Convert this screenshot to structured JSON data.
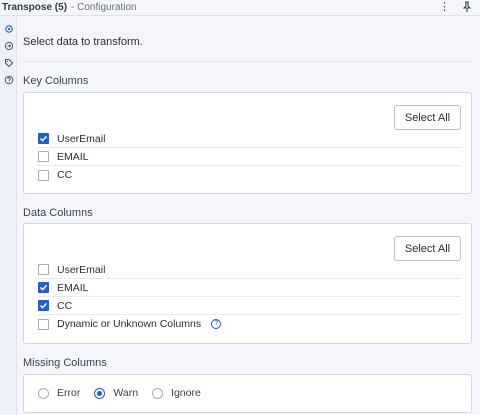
{
  "header": {
    "tool_name": "Transpose (5)",
    "subtitle": "- Configuration",
    "menu_icon": "more-vertical-icon",
    "pin_icon": "pin-icon"
  },
  "sidebar": {
    "icons": [
      "gear-icon",
      "arrow-circle-icon",
      "tag-icon",
      "help-circle-icon"
    ]
  },
  "intro": "Select data to transform.",
  "key_columns": {
    "title": "Key Columns",
    "select_all": "Select All",
    "items": [
      {
        "label": "UserEmail",
        "checked": true
      },
      {
        "label": "EMAIL",
        "checked": false
      },
      {
        "label": "CC",
        "checked": false
      }
    ]
  },
  "data_columns": {
    "title": "Data Columns",
    "select_all": "Select All",
    "items": [
      {
        "label": "UserEmail",
        "checked": false
      },
      {
        "label": "EMAIL",
        "checked": true
      },
      {
        "label": "CC",
        "checked": true
      },
      {
        "label": "Dynamic or Unknown Columns",
        "checked": false
      }
    ]
  },
  "missing_columns": {
    "title": "Missing Columns",
    "options": [
      {
        "label": "Error",
        "selected": false
      },
      {
        "label": "Warn",
        "selected": true
      },
      {
        "label": "Ignore",
        "selected": false
      }
    ]
  },
  "colors": {
    "accent": "#1f5fd6",
    "background": "#f4f6fb"
  }
}
